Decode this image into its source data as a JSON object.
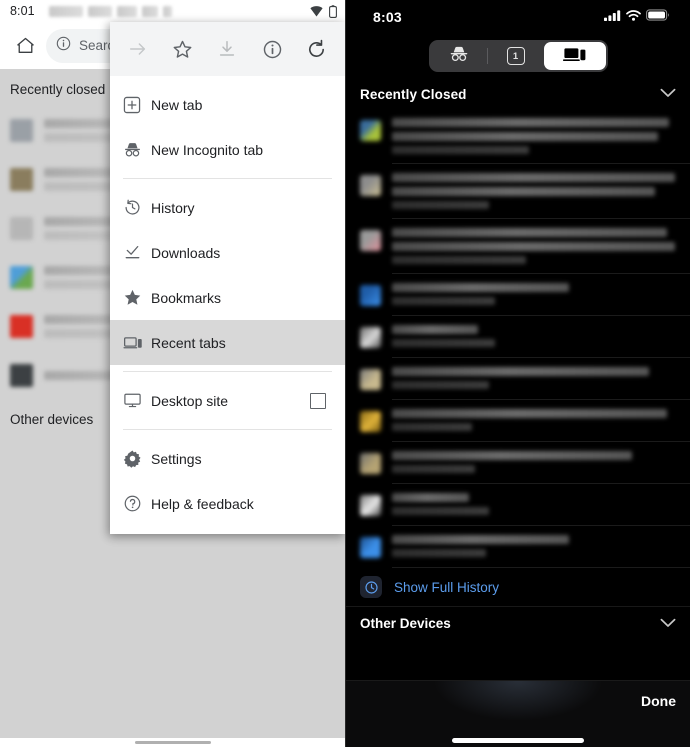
{
  "android": {
    "status_bar": {
      "time": "8:01",
      "icons": [
        "wifi-icon",
        "battery-icon"
      ]
    },
    "toolbar": {
      "home_icon": "home-icon",
      "omnibox": {
        "security_icon": "info-circle-icon",
        "text": "Search"
      }
    },
    "page": {
      "recently_closed_title": "Recently closed",
      "other_devices_title": "Other devices",
      "recently_closed_items": [
        {
          "favicon_color": "#9aa0a6"
        },
        {
          "favicon_color": "#8a7d5e"
        },
        {
          "favicon_color": "#b6b6b6"
        },
        {
          "favicon_color": "#6aa84f"
        },
        {
          "favicon_color": "#d93025"
        },
        {
          "favicon_color": "#3c4043"
        }
      ]
    },
    "overflow_menu": {
      "quick_actions": [
        {
          "name": "forward-icon",
          "label": "Forward",
          "disabled": true
        },
        {
          "name": "star-icon",
          "label": "Bookmark",
          "disabled": false
        },
        {
          "name": "download-icon",
          "label": "Download",
          "disabled": true
        },
        {
          "name": "page-info-icon",
          "label": "Page info",
          "disabled": false
        },
        {
          "name": "reload-icon",
          "label": "Reload",
          "disabled": false
        }
      ],
      "items": [
        {
          "label": "New tab",
          "icon": "new-tab-icon",
          "selected": false
        },
        {
          "label": "New Incognito tab",
          "icon": "incognito-icon",
          "selected": false
        },
        {
          "label": "History",
          "icon": "history-icon",
          "selected": false
        },
        {
          "label": "Downloads",
          "icon": "downloads-icon",
          "selected": false
        },
        {
          "label": "Bookmarks",
          "icon": "star-filled-icon",
          "selected": false
        },
        {
          "label": "Recent tabs",
          "icon": "recent-tabs-icon",
          "selected": true
        },
        {
          "label": "Desktop site",
          "icon": "desktop-icon",
          "selected": false,
          "checkbox": false
        },
        {
          "label": "Settings",
          "icon": "gear-icon",
          "selected": false
        },
        {
          "label": "Help & feedback",
          "icon": "help-circle-icon",
          "selected": false
        }
      ]
    }
  },
  "ios": {
    "status_bar": {
      "time": "8:03",
      "icons": [
        "cellular-signal-icon",
        "wifi-icon",
        "battery-icon"
      ]
    },
    "segmented_control": {
      "segments": [
        {
          "name": "incognito-tabs-tab",
          "icon": "incognito-icon",
          "label": "",
          "active": false
        },
        {
          "name": "regular-tabs-tab",
          "icon": "tab-count-icon",
          "label": "1",
          "active": false
        },
        {
          "name": "recent-tabs-tab",
          "icon": "recent-tabs-icon",
          "label": "",
          "active": true
        }
      ]
    },
    "recently_closed": {
      "title": "Recently Closed",
      "collapse_icon": "chevron-down-icon",
      "items": [
        {
          "favicon_color": "#a8c23a",
          "lines": 3
        },
        {
          "favicon_color": "#cbbf93",
          "lines": 3
        },
        {
          "favicon_color": "#e0909a",
          "lines": 3
        },
        {
          "favicon_color": "#2f7fe0",
          "lines": 2
        },
        {
          "favicon_color": "#d8d8d8",
          "lines": 3
        },
        {
          "favicon_color": "#c8b98e",
          "lines": 3
        },
        {
          "favicon_color": "#e0b33a",
          "lines": 3
        },
        {
          "favicon_color": "#b5a373",
          "lines": 2
        },
        {
          "favicon_color": "#e8e8e8",
          "lines": 2
        },
        {
          "favicon_color": "#3c8fe8",
          "lines": 2
        }
      ]
    },
    "show_full_history": {
      "label": "Show Full History",
      "icon": "history-clock-icon",
      "color": "#5c9ded"
    },
    "other_devices": {
      "title": "Other Devices",
      "collapse_icon": "chevron-down-icon"
    },
    "bottom_bar": {
      "done_label": "Done"
    }
  }
}
